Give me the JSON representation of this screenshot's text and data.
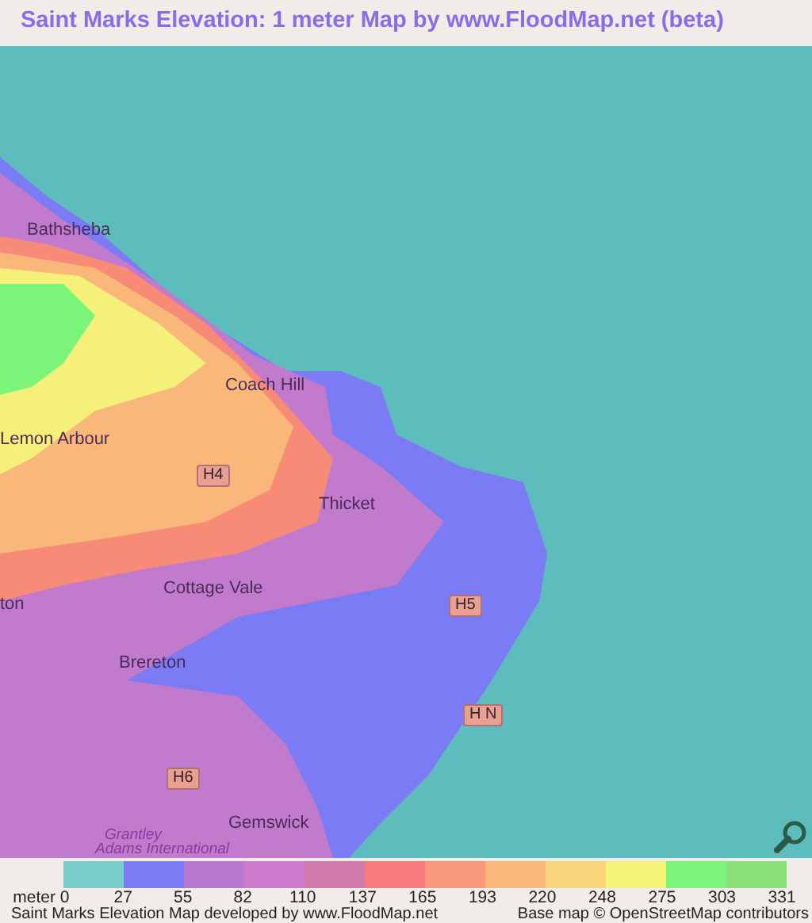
{
  "title": "Saint Marks Elevation: 1 meter Map by www.FloodMap.net (beta)",
  "map": {
    "labels": [
      {
        "text": "Bathsheba",
        "kind": "place"
      },
      {
        "text": "Coach Hill",
        "kind": "place"
      },
      {
        "text": "Lemon Arbour",
        "kind": "place"
      },
      {
        "text": "H4",
        "kind": "road"
      },
      {
        "text": "Thicket",
        "kind": "place"
      },
      {
        "text": "ton",
        "kind": "place"
      },
      {
        "text": "Cottage Vale",
        "kind": "place"
      },
      {
        "text": "H5",
        "kind": "road"
      },
      {
        "text": "Brereton",
        "kind": "place"
      },
      {
        "text": "H N",
        "kind": "road"
      },
      {
        "text": "H6",
        "kind": "road"
      },
      {
        "text": "Gemswick",
        "kind": "place"
      },
      {
        "text": "Grantley",
        "kind": "poi"
      },
      {
        "text": "Adams International",
        "kind": "poi"
      }
    ]
  },
  "legend": {
    "swatches": [
      {
        "color": "#7acfca"
      },
      {
        "color": "#7b7bf5"
      },
      {
        "color": "#b87ad0"
      },
      {
        "color": "#cc7acb"
      },
      {
        "color": "#d07aae"
      },
      {
        "color": "#f87a7a"
      },
      {
        "color": "#f9977a"
      },
      {
        "color": "#f9b87a"
      },
      {
        "color": "#f8d57a"
      },
      {
        "color": "#f5f57a"
      },
      {
        "color": "#7af57a"
      },
      {
        "color": "#8ce07a"
      }
    ],
    "ticks": [
      "meter 0",
      "27",
      "55",
      "82",
      "110",
      "137",
      "165",
      "193",
      "220",
      "248",
      "275",
      "303",
      "331"
    ]
  },
  "footer": {
    "left": "Saint Marks Elevation Map developed by www.FloodMap.net",
    "right": "Base map © OpenStreetMap contributors"
  }
}
